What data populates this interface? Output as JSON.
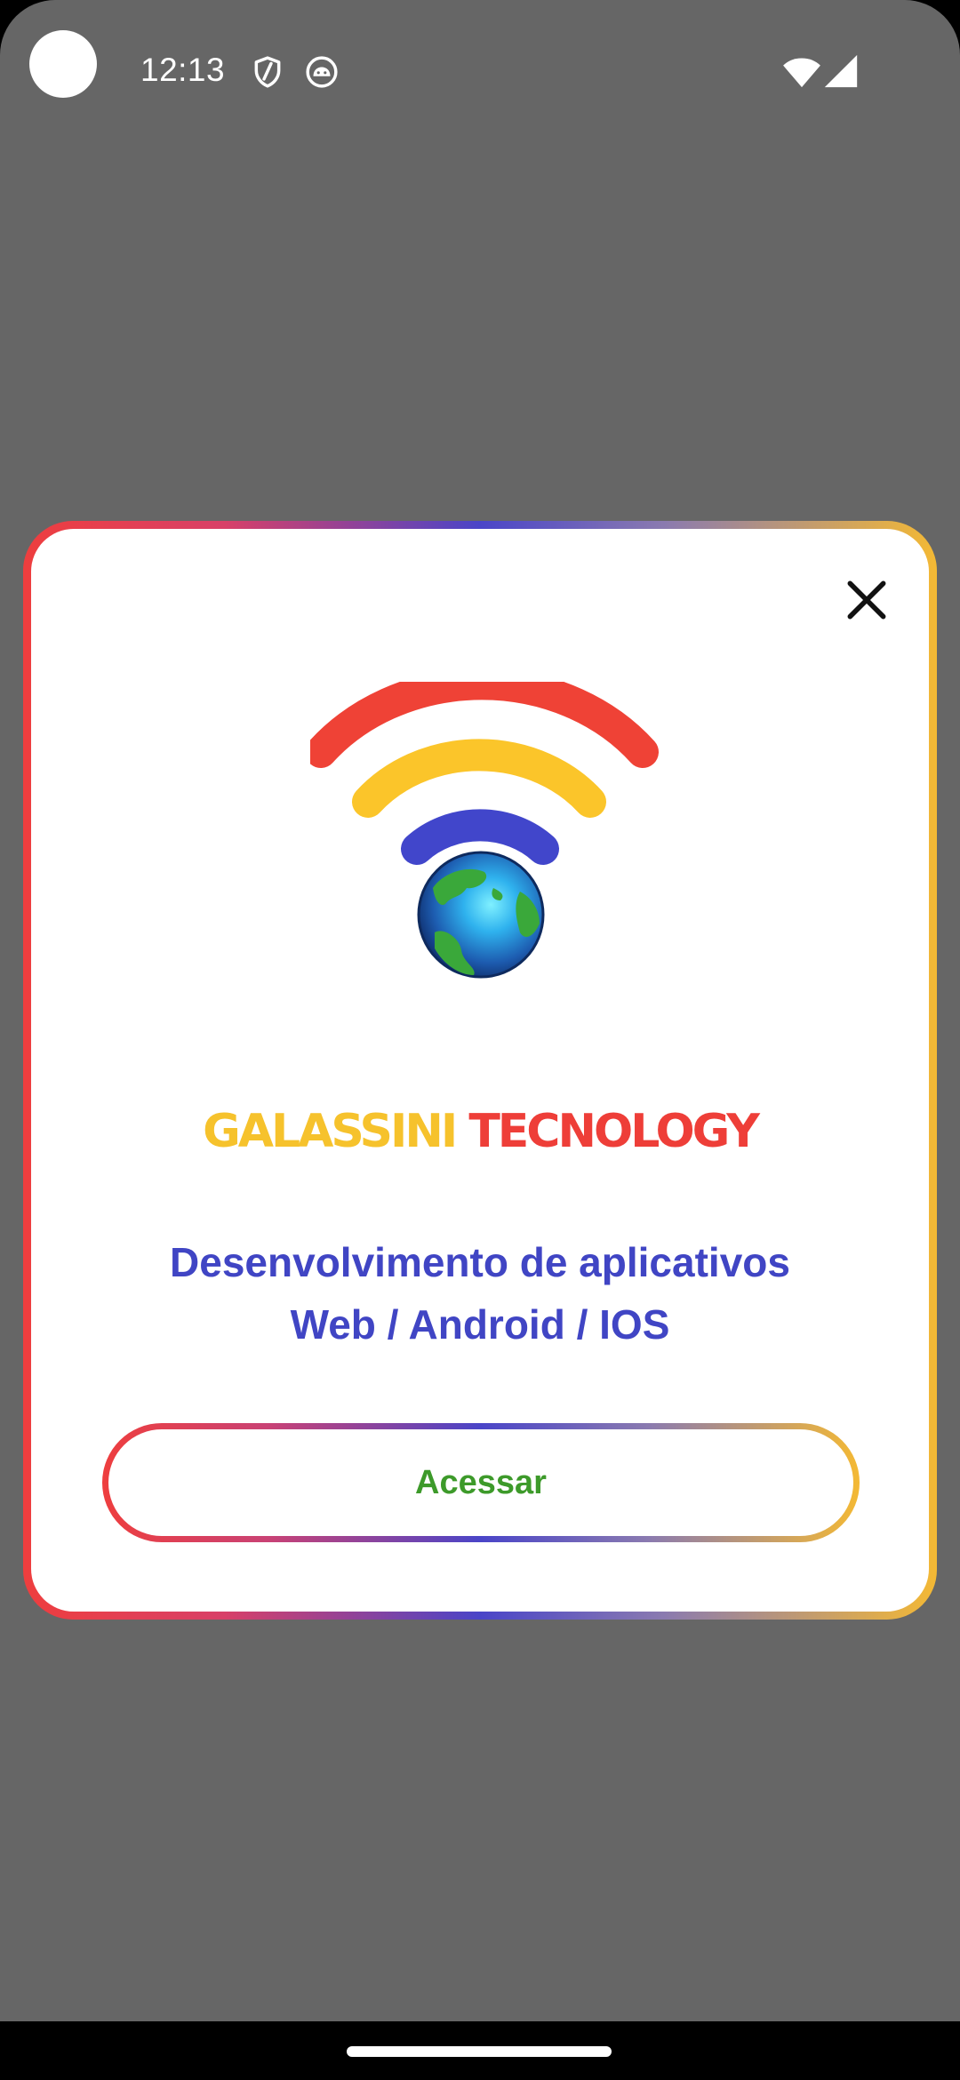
{
  "status_bar": {
    "time": "12:13",
    "icons": [
      "shield-icon",
      "android-debug-icon",
      "wifi-icon",
      "cellular-signal-icon"
    ]
  },
  "dialog": {
    "brand": {
      "part1": "GALASSINI",
      "part2": "TECNOLOGY",
      "colors": {
        "part1": "#f6c22c",
        "part2": "#ee3e38"
      }
    },
    "tagline": {
      "line1": "Desenvolvimento de aplicativos",
      "line2": "Web / Android / IOS"
    },
    "access_button_label": "Acessar",
    "logo_icon": "wifi-globe-logo-icon",
    "close_icon": "close-icon"
  },
  "colors": {
    "backdrop": "#666666",
    "tagline": "#4045c4",
    "access_label": "#3d9a2a",
    "gradient": [
      "#ee3e3e",
      "#4a45c8",
      "#f4b934"
    ]
  }
}
